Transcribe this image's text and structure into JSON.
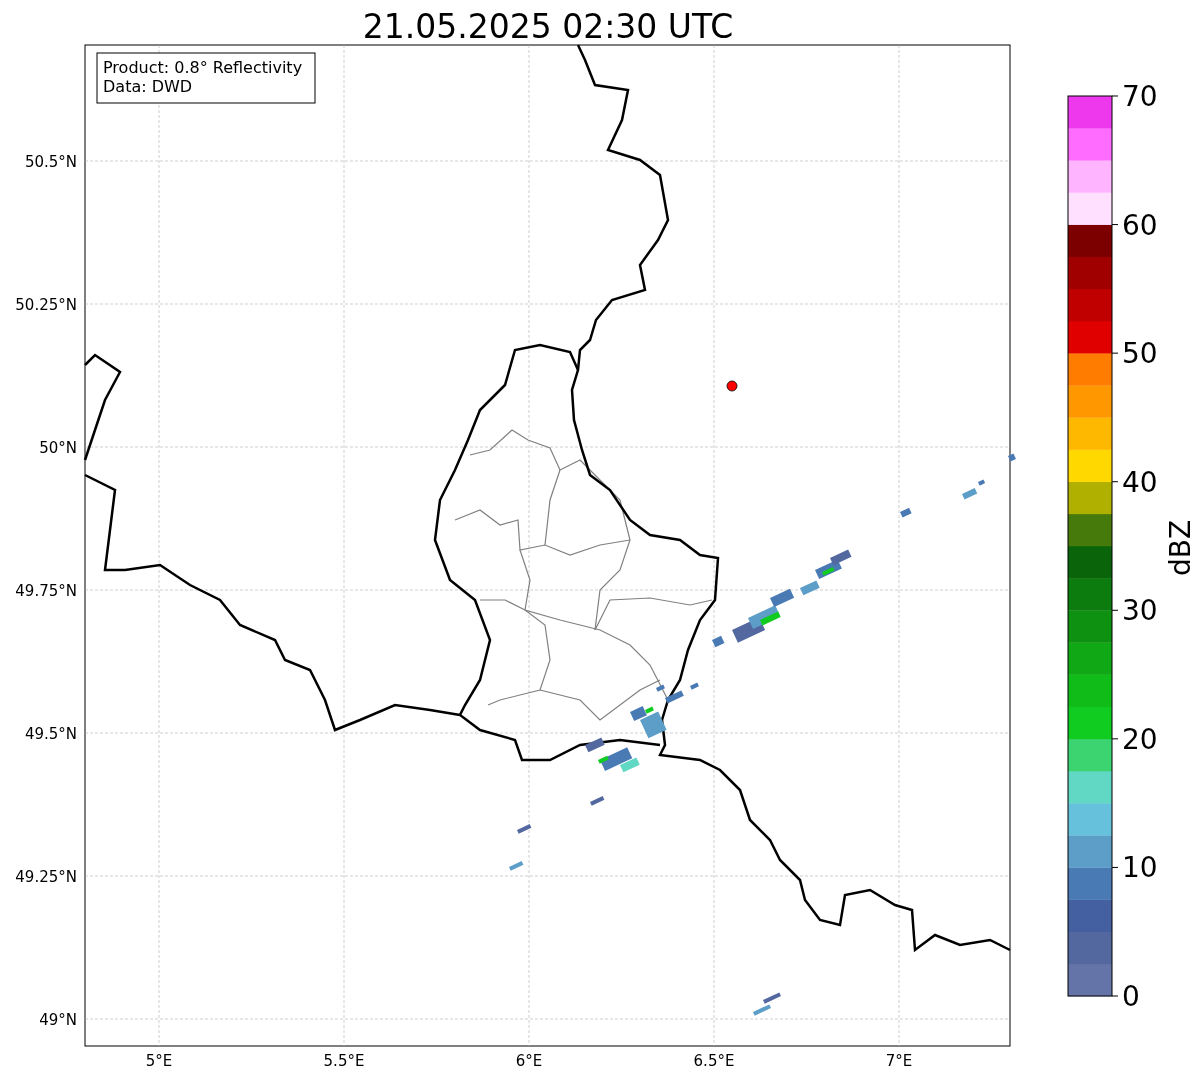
{
  "title": "21.05.2025 02:30 UTC",
  "info_box": {
    "lines": [
      "Product: 0.8° Reflectivity",
      "Data: DWD"
    ]
  },
  "map": {
    "lat_ticks": [
      "50.5°N",
      "50.25°N",
      "50°N",
      "49.75°N",
      "49.5°N",
      "49.25°N",
      "49°N"
    ],
    "lon_ticks": [
      "5°E",
      "5.5°E",
      "6°E",
      "6.5°E",
      "7°E"
    ]
  },
  "colorbar": {
    "label": "dBZ",
    "ticks": [
      "70",
      "60",
      "50",
      "40",
      "30",
      "20",
      "10",
      "0"
    ],
    "segments": [
      {
        "color": "#6474a8"
      },
      {
        "color": "#5468a0"
      },
      {
        "color": "#4460a0"
      },
      {
        "color": "#4a7ab4"
      },
      {
        "color": "#5c9ec8"
      },
      {
        "color": "#66c2dc"
      },
      {
        "color": "#60d8c4"
      },
      {
        "color": "#3cd470"
      },
      {
        "color": "#10cc20"
      },
      {
        "color": "#10bc18"
      },
      {
        "color": "#10a814"
      },
      {
        "color": "#0e9010"
      },
      {
        "color": "#0c7c0e"
      },
      {
        "color": "#0a640a"
      },
      {
        "color": "#467a0a"
      },
      {
        "color": "#b0b000"
      },
      {
        "color": "#ffd800"
      },
      {
        "color": "#ffb800"
      },
      {
        "color": "#ff9800"
      },
      {
        "color": "#ff7c00"
      },
      {
        "color": "#e00000"
      },
      {
        "color": "#c00000"
      },
      {
        "color": "#a00000"
      },
      {
        "color": "#7c0000"
      },
      {
        "color": "#ffe0ff"
      },
      {
        "color": "#ffb4ff"
      },
      {
        "color": "#ff6cff"
      },
      {
        "color": "#ee38ee"
      }
    ]
  }
}
